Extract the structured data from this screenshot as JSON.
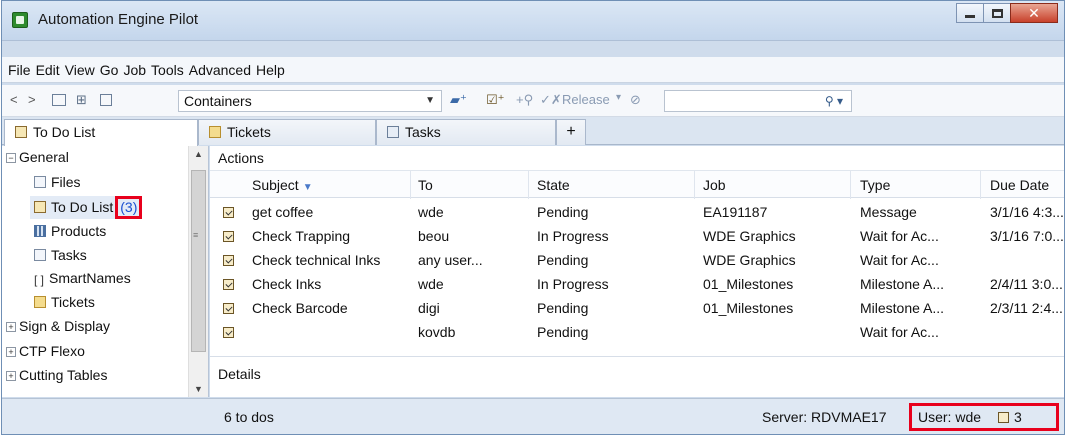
{
  "window": {
    "title": "Automation Engine Pilot"
  },
  "menu": [
    "File",
    "Edit",
    "View",
    "Go",
    "Job",
    "Tools",
    "Advanced",
    "Help"
  ],
  "toolbar": {
    "container_select": "Containers",
    "release_label": "Release",
    "search_placeholder": ""
  },
  "tabs": [
    {
      "label": "To Do List",
      "active": true
    },
    {
      "label": "Tickets",
      "active": false
    },
    {
      "label": "Tasks",
      "active": false
    },
    {
      "label": "+",
      "active": false
    }
  ],
  "sidebar": {
    "groups": [
      {
        "label": "General",
        "expanded": true
      },
      {
        "label": "Sign & Display",
        "expanded": false
      },
      {
        "label": "CTP Flexo",
        "expanded": false
      },
      {
        "label": "Cutting Tables",
        "expanded": false
      }
    ],
    "items": [
      {
        "label": "Files",
        "icon": "file-icon"
      },
      {
        "label": "To Do List",
        "icon": "todo-icon",
        "count": "(3)",
        "selected": true
      },
      {
        "label": "Products",
        "icon": "products-icon"
      },
      {
        "label": "Tasks",
        "icon": "tasks-icon"
      },
      {
        "label": "SmartNames",
        "icon": "smartnames-icon"
      },
      {
        "label": "Tickets",
        "icon": "tickets-icon"
      }
    ]
  },
  "actions": {
    "title": "Actions",
    "columns": [
      "Subject",
      "To",
      "State",
      "Job",
      "Type",
      "Due Date"
    ],
    "rows": [
      {
        "subject": "get coffee",
        "to": "wde",
        "state": "Pending",
        "job": "EA191187",
        "type": "Message",
        "due": "3/1/16 4:3..."
      },
      {
        "subject": "Check Trapping",
        "to": "beou",
        "state": "In Progress",
        "job": "WDE Graphics",
        "type": "Wait for Ac...",
        "due": "3/1/16 7:0..."
      },
      {
        "subject": "Check technical Inks",
        "to": "any user...",
        "state": "Pending",
        "job": "WDE Graphics",
        "type": "Wait for Ac...",
        "due": ""
      },
      {
        "subject": "Check Inks",
        "to": "wde",
        "state": "In Progress",
        "job": "01_Milestones",
        "type": "Milestone A...",
        "due": "2/4/11 3:0..."
      },
      {
        "subject": "Check Barcode",
        "to": "digi",
        "state": "Pending",
        "job": "01_Milestones",
        "type": "Milestone A...",
        "due": "2/3/11 2:4..."
      },
      {
        "subject": "",
        "to": "kovdb",
        "state": "Pending",
        "job": "",
        "type": "Wait for Ac...",
        "due": ""
      }
    ]
  },
  "details": {
    "title": "Details"
  },
  "status": {
    "count_text": "6 to dos",
    "server": "Server: RDVMAE17",
    "user": "User: wde",
    "todo_count": "3"
  }
}
